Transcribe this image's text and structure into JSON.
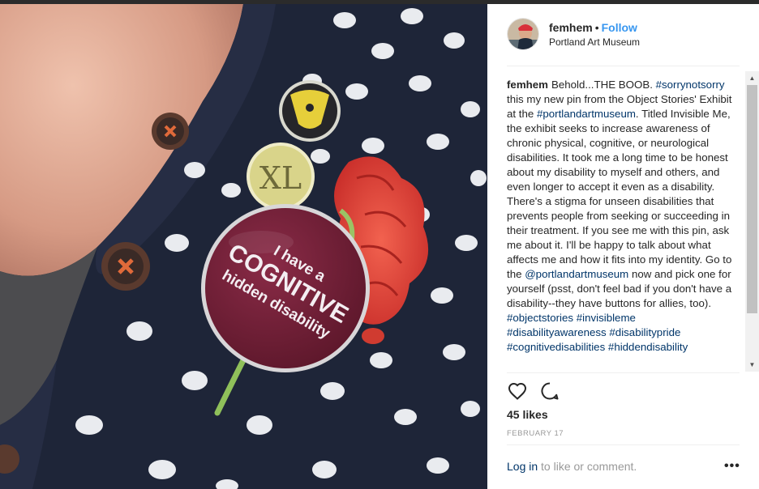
{
  "post": {
    "username": "femhem",
    "separator": "•",
    "follow_label": "Follow",
    "location": "Portland Art Museum"
  },
  "caption": {
    "username": "femhem",
    "segments": [
      {
        "text": "Behold...THE BOOB. ",
        "type": "text"
      },
      {
        "text": "#sorrynotsorry",
        "type": "tag"
      },
      {
        "text": " this my new pin from the Object Stories' Exhibit at the ",
        "type": "text"
      },
      {
        "text": "#portlandartmuseum",
        "type": "tag"
      },
      {
        "text": ". Titled Invisible Me, the exhibit seeks to increase awareness of chronic physical, cognitive, or neurological disabilities. It took me a long time to be honest about my disability to myself and others, and even longer to accept it even as a disability. There's a stigma for unseen disabilities that prevents people from seeking or succeeding in their treatment. If you see me with this pin, ask me about it. I'll be happy to talk about what affects me and how it fits into my identity. Go to the ",
        "type": "text"
      },
      {
        "text": "@portlandartmuseum",
        "type": "tag"
      },
      {
        "text": " now and pick one for yourself (psst, don't feel bad if you don't have a disability--they have buttons for allies, too). ",
        "type": "text"
      },
      {
        "text": "#objectstories",
        "type": "tag"
      },
      {
        "text": " ",
        "type": "text"
      },
      {
        "text": "#invisibleme",
        "type": "tag"
      },
      {
        "text": " ",
        "type": "text"
      },
      {
        "text": "#disabilityawareness",
        "type": "tag"
      },
      {
        "text": " ",
        "type": "text"
      },
      {
        "text": "#disabilitypride",
        "type": "tag"
      },
      {
        "text": " ",
        "type": "text"
      },
      {
        "text": "#cognitivedisabilities",
        "type": "tag"
      },
      {
        "text": " ",
        "type": "text"
      },
      {
        "text": "#hiddendisability",
        "type": "tag"
      }
    ]
  },
  "photo": {
    "pin_text": [
      "I have a",
      "COGNITIVE",
      "hidden disability"
    ],
    "small_pin_text": "XL",
    "colors": {
      "sweater": "#1e2538",
      "pin": "#6e1f36",
      "flower": "#e8453b",
      "pin_yellow": "#d9d48a"
    }
  },
  "actions": {
    "like_icon": "heart-icon",
    "comment_icon": "comment-icon"
  },
  "likes": "45 likes",
  "date": "FEBRUARY 17",
  "login": {
    "link_label": "Log in",
    "rest_text": " to like or comment."
  },
  "more_icon": "more-options-icon",
  "more_label": "•••",
  "scroll_up": "▲",
  "scroll_down": "▼"
}
